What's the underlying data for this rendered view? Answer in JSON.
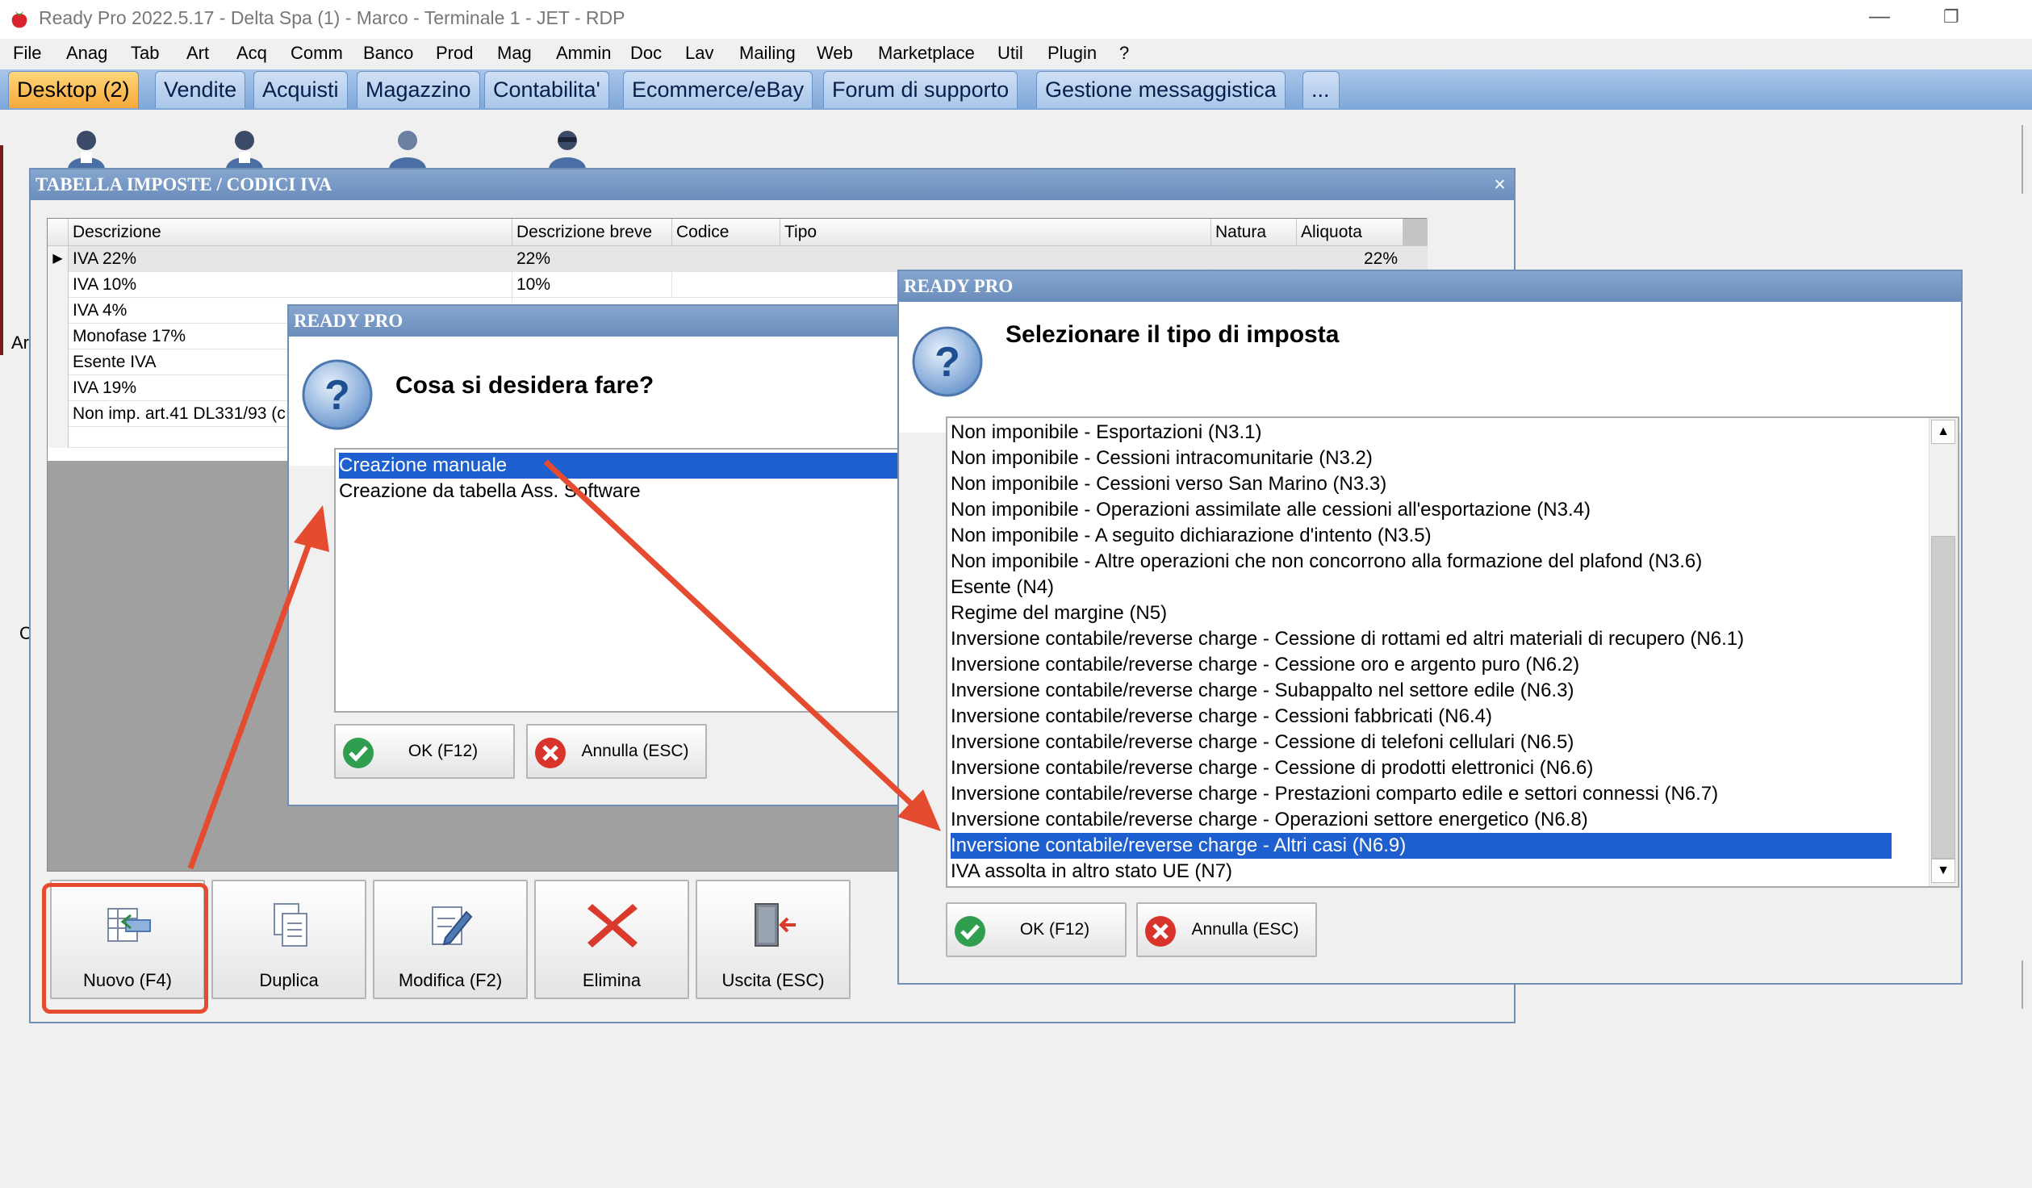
{
  "window": {
    "title": "Ready Pro 2022.5.17 - Delta Spa (1) - Marco - Terminale 1 - JET - RDP",
    "minimize": "—",
    "restore": "❐"
  },
  "menu": [
    "File",
    "Anag",
    "Tab",
    "Art",
    "Acq",
    "Comm",
    "Banco",
    "Prod",
    "Mag",
    "Ammin",
    "Doc",
    "Lav",
    "Mailing",
    "Web",
    "Marketplace",
    "Util",
    "Plugin",
    "?"
  ],
  "tabs": [
    "Desktop (2)",
    "Vendite",
    "Acquisti",
    "Magazzino",
    "Contabilita'",
    "Ecommerce/eBay",
    "Forum di supporto",
    "Gestione messaggistica",
    "..."
  ],
  "background_fragments": [
    "Ar",
    "C"
  ],
  "tax_window": {
    "title": "TABELLA IMPOSTE / CODICI IVA",
    "close": "×",
    "columns": [
      "Descrizione",
      "Descrizione breve",
      "Codice",
      "Tipo",
      "Natura",
      "Aliquota"
    ],
    "rows": [
      {
        "indicator": "▶",
        "descrizione": "IVA 22%",
        "breve": "22%",
        "aliquota": "22%"
      },
      {
        "indicator": "",
        "descrizione": "IVA 10%",
        "breve": "10%",
        "aliquota": ""
      },
      {
        "indicator": "",
        "descrizione": "IVA 4%",
        "breve": "",
        "aliquota": ""
      },
      {
        "indicator": "",
        "descrizione": "Monofase 17%",
        "breve": "",
        "aliquota": ""
      },
      {
        "indicator": "",
        "descrizione": "Esente IVA",
        "breve": "",
        "aliquota": ""
      },
      {
        "indicator": "",
        "descrizione": "IVA 19%",
        "breve": "",
        "aliquota": ""
      },
      {
        "indicator": "",
        "descrizione": "Non imp. art.41 DL331/93 (c",
        "breve": "",
        "aliquota": ""
      }
    ],
    "buttons": {
      "nuovo": "Nuovo (F4)",
      "duplica": "Duplica",
      "modifica": "Modifica (F2)",
      "elimina": "Elimina",
      "uscita": "Uscita (ESC)"
    }
  },
  "dialog1": {
    "title": "READY PRO",
    "question": "Cosa si desidera fare?",
    "options": [
      "Creazione manuale",
      "Creazione da tabella Ass. Software"
    ],
    "selected_index": 0,
    "ok": "OK (F12)",
    "cancel": "Annulla (ESC)"
  },
  "dialog2": {
    "title": "READY PRO",
    "question": "Selezionare il tipo di imposta",
    "options": [
      "Non imponibile - Esportazioni (N3.1)",
      "Non imponibile - Cessioni intracomunitarie (N3.2)",
      "Non imponibile - Cessioni verso San Marino (N3.3)",
      "Non imponibile - Operazioni assimilate alle cessioni all'esportazione (N3.4)",
      "Non imponibile - A seguito dichiarazione d'intento (N3.5)",
      "Non imponibile - Altre operazioni che non concorrono alla formazione del plafond (N3.6)",
      "Esente (N4)",
      "Regime del margine (N5)",
      "Inversione contabile/reverse charge - Cessione di rottami ed altri materiali di recupero (N6.1)",
      "Inversione contabile/reverse charge - Cessione oro e argento puro (N6.2)",
      "Inversione contabile/reverse charge - Subappalto nel settore edile (N6.3)",
      "Inversione contabile/reverse charge - Cessioni fabbricati (N6.4)",
      "Inversione contabile/reverse charge - Cessione di telefoni cellulari (N6.5)",
      "Inversione contabile/reverse charge - Cessione di prodotti elettronici (N6.6)",
      "Inversione contabile/reverse charge - Prestazioni comparto edile e settori connessi (N6.7)",
      "Inversione contabile/reverse charge - Operazioni settore energetico (N6.8)",
      "Inversione contabile/reverse charge - Altri casi (N6.9)",
      "IVA assolta in altro stato UE (N7)"
    ],
    "selected_index": 16,
    "scroll_up": "▲",
    "scroll_down": "▼",
    "ok": "OK (F12)",
    "cancel": "Annulla (ESC)"
  },
  "colors": {
    "annotation": "#e54b2f",
    "selection": "#1d5fcf",
    "window_header": "#6b8dbb",
    "active_tab": "#f6a83a"
  },
  "icons": [
    "app-strawberry-icon",
    "user-icon",
    "new-record-icon",
    "duplicate-icon",
    "edit-icon",
    "delete-icon",
    "exit-icon",
    "question-icon",
    "check-icon",
    "cancel-icon"
  ]
}
